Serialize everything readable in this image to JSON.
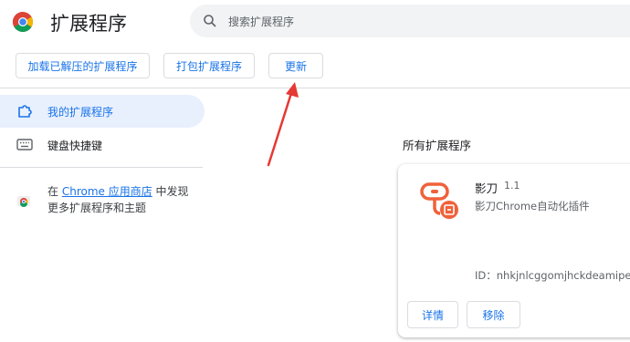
{
  "header": {
    "title": "扩展程序",
    "search_placeholder": "搜索扩展程序"
  },
  "toolbar": {
    "load_unpacked": "加载已解压的扩展程序",
    "pack": "打包扩展程序",
    "update": "更新"
  },
  "sidebar": {
    "items": [
      {
        "label": "我的扩展程序",
        "icon": "puzzle-icon",
        "active": true
      },
      {
        "label": "键盘快捷键",
        "icon": "keyboard-icon",
        "active": false
      }
    ],
    "store": {
      "prefix": "在 ",
      "link": "Chrome 应用商店",
      "suffix": " 中发现",
      "line2": "更多扩展程序和主题"
    }
  },
  "main": {
    "section_title": "所有扩展程序",
    "extensions": [
      {
        "name": "影刀",
        "version": "1.1",
        "description": "影刀Chrome自动化插件",
        "id_text": "ID：nhkjnlcggomjhckdeamipedlc",
        "details_label": "详情",
        "remove_label": "移除"
      }
    ]
  },
  "colors": {
    "accent": "#1a73e8",
    "nav_active_bg": "#e8f0fe",
    "annotation_arrow": "#e53935",
    "ext_icon": "#f0613a"
  }
}
